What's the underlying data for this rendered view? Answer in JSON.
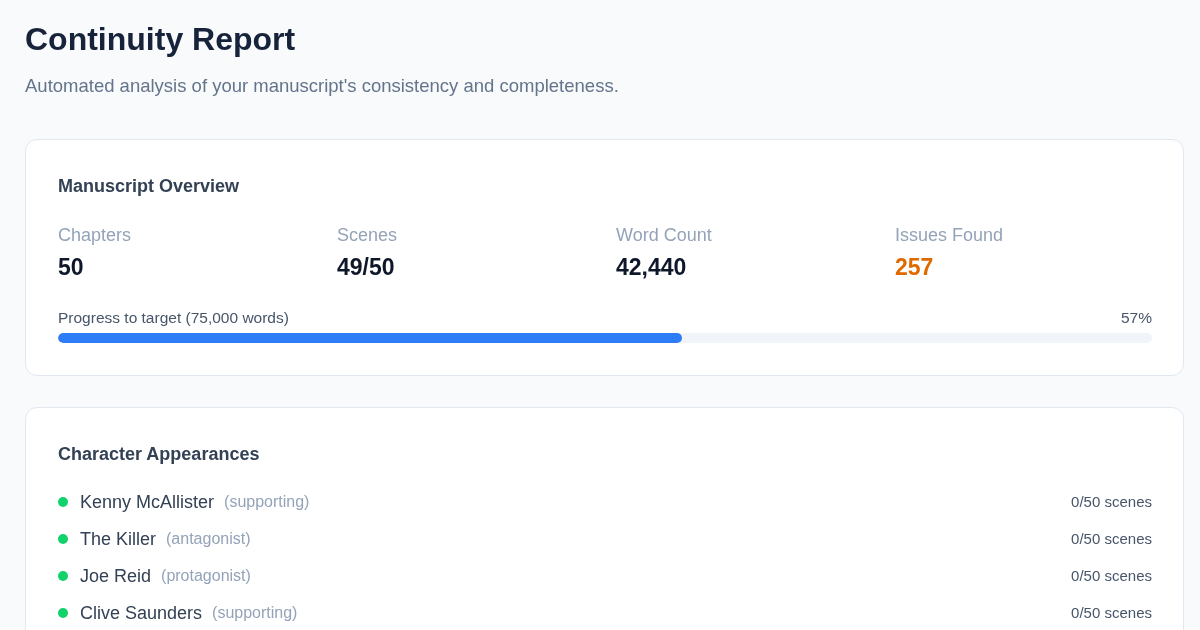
{
  "header": {
    "title": "Continuity Report",
    "subtitle": "Automated analysis of your manuscript's consistency and completeness."
  },
  "overview": {
    "title": "Manuscript Overview",
    "stats": [
      {
        "label": "Chapters",
        "value": "50",
        "kind": "plain"
      },
      {
        "label": "Scenes",
        "value": "49/50",
        "kind": "plain"
      },
      {
        "label": "Word Count",
        "value": "42,440",
        "kind": "plain"
      },
      {
        "label": "Issues Found",
        "value": "257",
        "kind": "warning"
      }
    ],
    "progress": {
      "label": "Progress to target (75,000 words)",
      "reading": "57%",
      "level": 0.57
    }
  },
  "characters": {
    "title": "Character Appearances",
    "items": [
      {
        "name": "Kenny McAllister",
        "role": "(supporting)",
        "scenes": "0/50 scenes",
        "color": "#12d36b"
      },
      {
        "name": "The Killer",
        "role": "(antagonist)",
        "scenes": "0/50 scenes",
        "color": "#12d36b"
      },
      {
        "name": "Joe Reid",
        "role": "(protagonist)",
        "scenes": "0/50 scenes",
        "color": "#12d36b"
      },
      {
        "name": "Clive Saunders",
        "role": "(supporting)",
        "scenes": "0/50 scenes",
        "color": "#12d36b"
      }
    ]
  }
}
